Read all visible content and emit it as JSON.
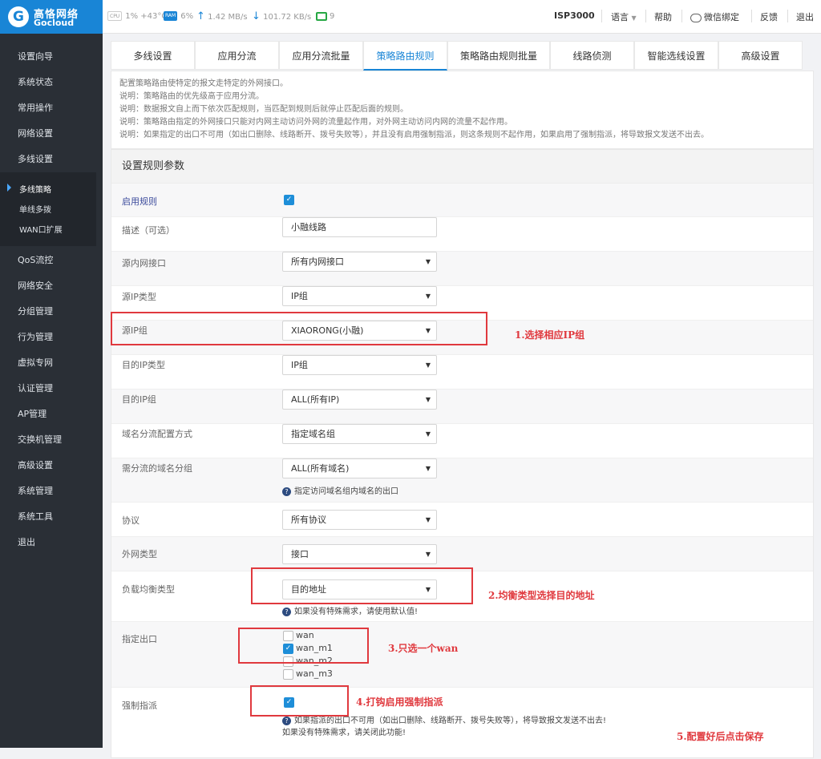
{
  "brand": {
    "name_cn": "高恪网络",
    "name_en": "Gocloud"
  },
  "status": {
    "cpu_chip": "CPU",
    "cpu_text": "1% +43°C",
    "ram_chip": "RAM",
    "ram_text": "6%",
    "up_text": "1.42 MB/s",
    "down_text": "101.72 KB/s",
    "devices": "9"
  },
  "topnav": {
    "model": "ISP3000",
    "language": "语言",
    "help": "帮助",
    "wechat": "微信绑定",
    "feedback": "反馈",
    "logout": "退出"
  },
  "sidebar": {
    "items": [
      "设置向导",
      "系统状态",
      "常用操作",
      "网络设置",
      "多线设置",
      "QoS流控",
      "网络安全",
      "分组管理",
      "行为管理",
      "虚拟专网",
      "认证管理",
      "AP管理",
      "交换机管理",
      "高级设置",
      "系统管理",
      "系统工具",
      "退出"
    ],
    "sub": [
      "多线策略",
      "单线多拨",
      "WAN口扩展"
    ]
  },
  "tabs": [
    "多线设置",
    "应用分流",
    "应用分流批量",
    "策略路由规则",
    "策略路由规则批量",
    "线路侦测",
    "智能选线设置",
    "高级设置"
  ],
  "notice": [
    "配置策略路由使特定的报文走特定的外网接口。",
    "说明：策略路由的优先级高于应用分流。",
    "说明：数据报文自上而下依次匹配规则，当匹配到规则后就停止匹配后面的规则。",
    "说明：策略路由指定的外网接口只能对内网主动访问外网的流量起作用，对外网主动访问内网的流量不起作用。",
    "说明：如果指定的出口不可用（如出口删除、线路断开、拨号失败等），并且没有启用强制指派，则这条规则不起作用，如果启用了强制指派，将导致报文发送不出去。"
  ],
  "form": {
    "title": "设置规则参数",
    "enable_label": "启用规则",
    "enable_checked": true,
    "desc_label": "描述（可选）",
    "desc_value": "小融线路",
    "src_if_label": "源内网接口",
    "src_if_value": "所有内网接口",
    "src_ip_type_label": "源IP类型",
    "src_ip_type_value": "IP组",
    "src_ip_group_label": "源IP组",
    "src_ip_group_value": "XIAORONG(小融)",
    "dst_ip_type_label": "目的IP类型",
    "dst_ip_type_value": "IP组",
    "dst_ip_group_label": "目的IP组",
    "dst_ip_group_value": "ALL(所有IP)",
    "domain_mode_label": "域名分流配置方式",
    "domain_mode_value": "指定域名组",
    "domain_group_label": "需分流的域名分组",
    "domain_group_value": "ALL(所有域名)",
    "domain_group_hint": "指定访问域名组内域名的出口",
    "protocol_label": "协议",
    "protocol_value": "所有协议",
    "wan_type_label": "外网类型",
    "wan_type_value": "接口",
    "lb_label": "负载均衡类型",
    "lb_value": "目的地址",
    "lb_hint": "如果没有特殊需求，请使用默认值!",
    "exit_label": "指定出口",
    "exits": [
      {
        "name": "wan",
        "checked": false
      },
      {
        "name": "wan_m1",
        "checked": true
      },
      {
        "name": "wan_m2",
        "checked": false
      },
      {
        "name": "wan_m3",
        "checked": false
      }
    ],
    "force_label": "强制指派",
    "force_checked": true,
    "force_hint1": "如果指派的出口不可用（如出口删除、线路断开、拨号失败等），将导致报文发送不出去!",
    "force_hint2": "如果没有特殊需求，请关闭此功能!"
  },
  "annotations": [
    "1.选择相应IP组",
    "2.均衡类型选择目的地址",
    "3.只选一个wan",
    "4.打钩启用强制指派",
    "5.配置好后点击保存"
  ],
  "colors": {
    "brand": "#1985d6",
    "annotation": "#e0393e",
    "sidebar": "#2a2f36",
    "checkbox": "#1e8ed8"
  }
}
